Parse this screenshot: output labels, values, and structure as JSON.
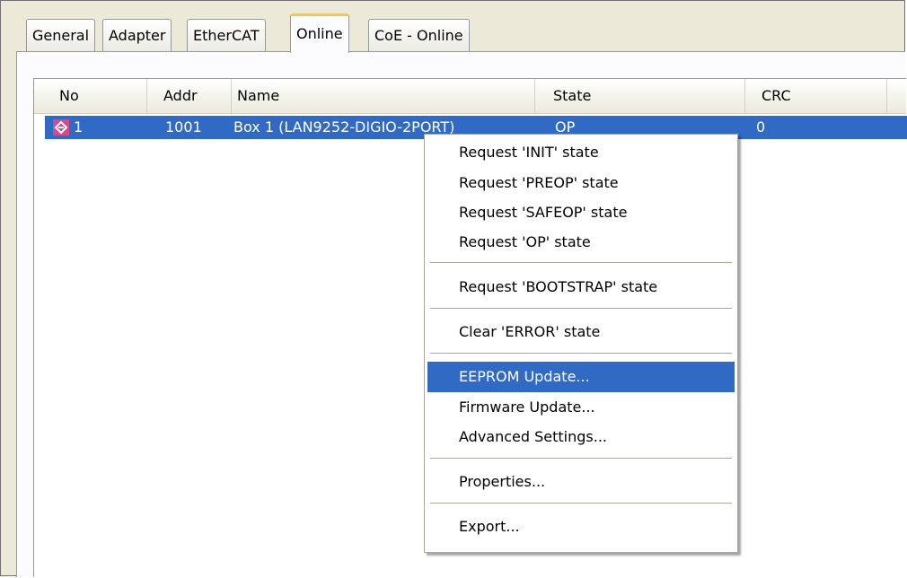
{
  "tabs": [
    {
      "label": "General"
    },
    {
      "label": "Adapter"
    },
    {
      "label": "EtherCAT"
    },
    {
      "label": "Online"
    },
    {
      "label": "CoE - Online"
    }
  ],
  "active_tab": "Online",
  "list": {
    "columns": [
      "No",
      "Addr",
      "Name",
      "State",
      "CRC"
    ],
    "rows": [
      {
        "no": "1",
        "addr": "1001",
        "name": "Box 1 (LAN9252-DIGIO-2PORT)",
        "state": "OP",
        "crc": "0",
        "icon": "ethercat-device-icon",
        "selected": true
      }
    ]
  },
  "context_menu": {
    "items": [
      {
        "label": "Request 'INIT' state"
      },
      {
        "label": "Request 'PREOP' state"
      },
      {
        "label": "Request 'SAFEOP' state"
      },
      {
        "label": "Request 'OP' state"
      },
      {
        "label": "Request 'BOOTSTRAP' state"
      },
      {
        "label": "Clear 'ERROR' state"
      },
      {
        "label": "EEPROM Update...",
        "highlighted": true
      },
      {
        "label": "Firmware Update..."
      },
      {
        "label": "Advanced Settings..."
      },
      {
        "label": "Properties..."
      },
      {
        "label": "Export..."
      }
    ]
  },
  "colors": {
    "selection": "#316ac5",
    "active_tab_accent": "#ffc83c",
    "dialog_background": "#ece9d8"
  }
}
